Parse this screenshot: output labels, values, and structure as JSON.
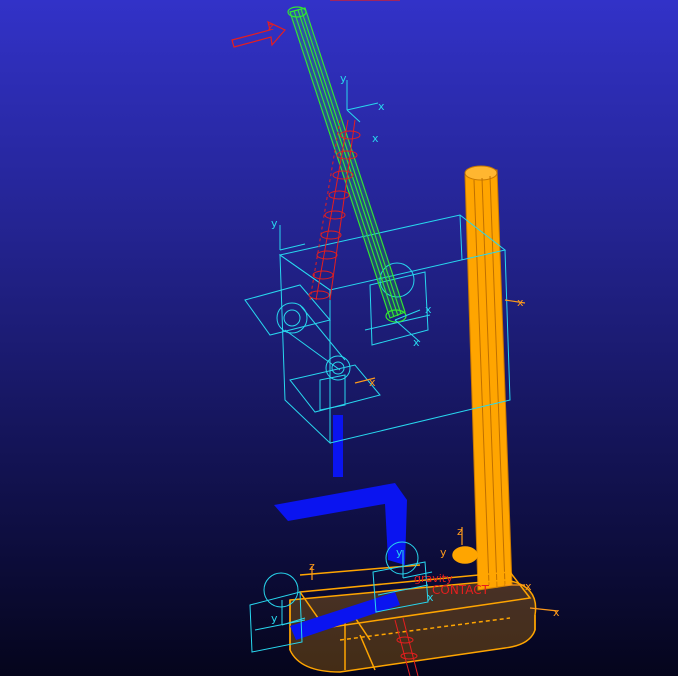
{
  "viewport": {
    "background_top": "#3232c8",
    "background_bottom": "#05051c"
  },
  "colors": {
    "pillar": "#ffa500",
    "base": "#ffa500",
    "blue_link": "#0a14f0",
    "green_link": "#32e632",
    "spring": "#e61e1e",
    "wireframe": "#28d7ee",
    "triad": "#ff9a1a"
  },
  "labels": {
    "gravity": "gravity",
    "contact": "CONTACT",
    "axis_x": "x",
    "axis_y": "y",
    "axis_z": "z"
  }
}
